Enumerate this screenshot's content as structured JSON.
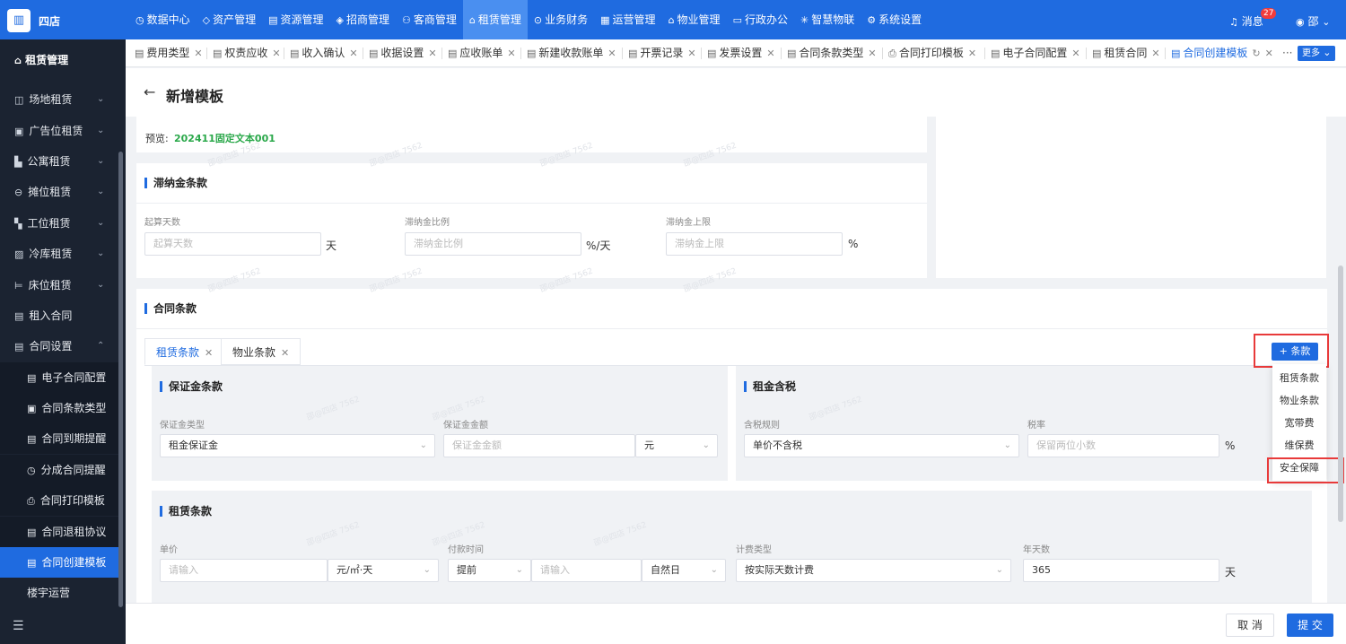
{
  "topnav": {
    "shop_name": "四店",
    "menu": [
      "数据中心",
      "资产管理",
      "资源管理",
      "招商管理",
      "客商管理",
      "租赁管理",
      "业务财务",
      "运营管理",
      "物业管理",
      "行政办公",
      "智慧物联",
      "系统设置"
    ],
    "active_menu": "租赁管理",
    "message_label": "消息",
    "message_count": "27",
    "user": "邵"
  },
  "sidebar": {
    "title": "租赁管理",
    "items": [
      "场地租赁",
      "广告位租赁",
      "公寓租赁",
      "摊位租赁",
      "工位租赁",
      "冷库租赁",
      "床位租赁",
      "租入合同",
      "合同设置"
    ],
    "sub_items": [
      "电子合同配置",
      "合同条款类型",
      "合同到期提醒",
      "分成合同提醒",
      "合同打印模板",
      "合同退租协议",
      "合同创建模板"
    ],
    "after": "楼宇运营",
    "active_sub": "合同创建模板"
  },
  "tabs": [
    "费用类型",
    "权责应收",
    "收入确认",
    "收据设置",
    "应收账单",
    "新建收款账单",
    "开票记录",
    "发票设置",
    "合同条款类型",
    "合同打印模板",
    "电子合同配置",
    "租赁合同",
    "合同创建模板"
  ],
  "tabs_more": "更多",
  "page": {
    "title": "新增模板",
    "preview_label": "预览:",
    "preview_value": "202411固定文本001"
  },
  "late_fee": {
    "title": "滞纳金条款",
    "fields": [
      {
        "label": "起算天数",
        "placeholder": "起算天数",
        "unit": "天"
      },
      {
        "label": "滞纳金比例",
        "placeholder": "滞纳金比例",
        "unit": "%/天"
      },
      {
        "label": "滞纳金上限",
        "placeholder": "滞纳金上限",
        "unit": "%"
      }
    ]
  },
  "contract_terms": {
    "title": "合同条款",
    "subtabs": [
      "租赁条款",
      "物业条款"
    ],
    "add_button": "+ 条款",
    "dropdown": [
      "租赁条款",
      "物业条款",
      "宽带费",
      "维保费",
      "安全保障"
    ]
  },
  "deposit": {
    "title": "保证金条款",
    "type_label": "保证金类型",
    "type_value": "租金保证金",
    "amount_label": "保证金金额",
    "amount_placeholder": "保证金金额",
    "amount_unit": "元"
  },
  "rent_tax": {
    "title": "租金含税",
    "rule_label": "含税规则",
    "rule_value": "单价不含税",
    "rate_label": "税率",
    "rate_placeholder": "保留两位小数",
    "rate_unit": "%"
  },
  "lease": {
    "title": "租赁条款",
    "price_label": "单价",
    "price_placeholder": "请输入",
    "price_unit": "元/㎡·天",
    "pay_label": "付款时间",
    "pay_mode": "提前",
    "pay_placeholder": "请输入",
    "pay_daytype": "自然日",
    "calc_label": "计费类型",
    "calc_value": "按实际天数计费",
    "year_label": "年天数",
    "year_value": "365",
    "year_unit": "天"
  },
  "watermark": "邵@四店 7562",
  "footer": {
    "cancel": "取 消",
    "submit": "提 交"
  }
}
